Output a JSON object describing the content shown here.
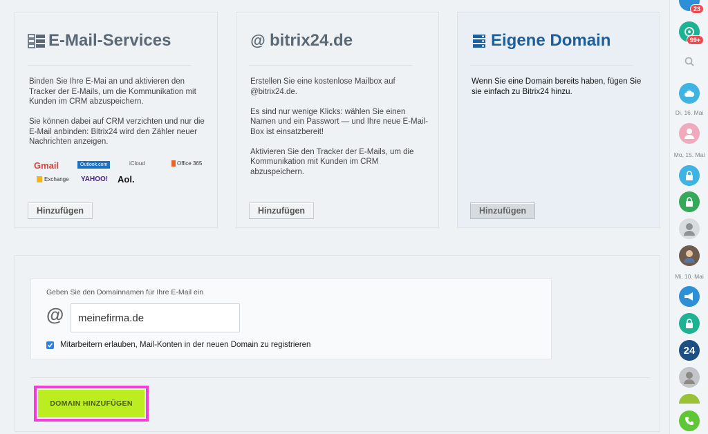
{
  "cards": [
    {
      "title": "E-Mail-Services",
      "icon": "server-icon",
      "paragraphs": [
        "Binden Sie Ihre E-Mai an und aktivieren den Tracker der E-Mails, um die Kommunikation mit Kunden im CRM abzuspeichern.",
        "Sie können dabei auf CRM verzichten und nur die E-Mail anbinden: Bitrix24 wird den Zähler neuer Nachrichten anzeigen."
      ],
      "logos": [
        "Gmail",
        "Outlook.com",
        "iCloud",
        "Office 365",
        "Exchange",
        "YAHOO!",
        "Aol."
      ],
      "button": "Hinzufügen"
    },
    {
      "title": "bitrix24.de",
      "icon": "at-icon",
      "paragraphs": [
        "Erstellen Sie eine kostenlose Mailbox auf @bitrix24.de.",
        "Es sind nur wenige Klicks: wählen Sie einen Namen und ein Passwort — und Ihre neue E-Mail-Box ist einsatzbereit!",
        "Aktivieren Sie den Tracker der E-Mails, um die Kommunikation mit Kunden im CRM abzuspeichern."
      ],
      "button": "Hinzufügen"
    },
    {
      "title": "Eigene Domain",
      "icon": "server-icon",
      "paragraphs": [
        "Wenn Sie eine Domain bereits haben, fügen Sie sie einfach zu Bitrix24 hinzu."
      ],
      "button": "Hinzufügen"
    }
  ],
  "domain_form": {
    "label": "Geben Sie den Domainnamen für Ihre E-Mail ein",
    "at_symbol": "@",
    "input_value": "meinefirma.de",
    "checkbox_checked": true,
    "checkbox_label": "Mitarbeitern erlauben, Mail-Konten in der neuen Domain zu registrieren",
    "submit": "DOMAIN HINZUFÜGEN"
  },
  "sidebar": {
    "badges": [
      "23",
      "99+"
    ],
    "dates": [
      "Di, 16. Mai",
      "Mo, 15. Mai",
      "Mi, 10. Mai"
    ],
    "app_label": "24"
  },
  "colors": {
    "accent_blue": "#1c5f9c",
    "submit_green": "#bbed21",
    "highlight_pink": "#f53ed8"
  }
}
